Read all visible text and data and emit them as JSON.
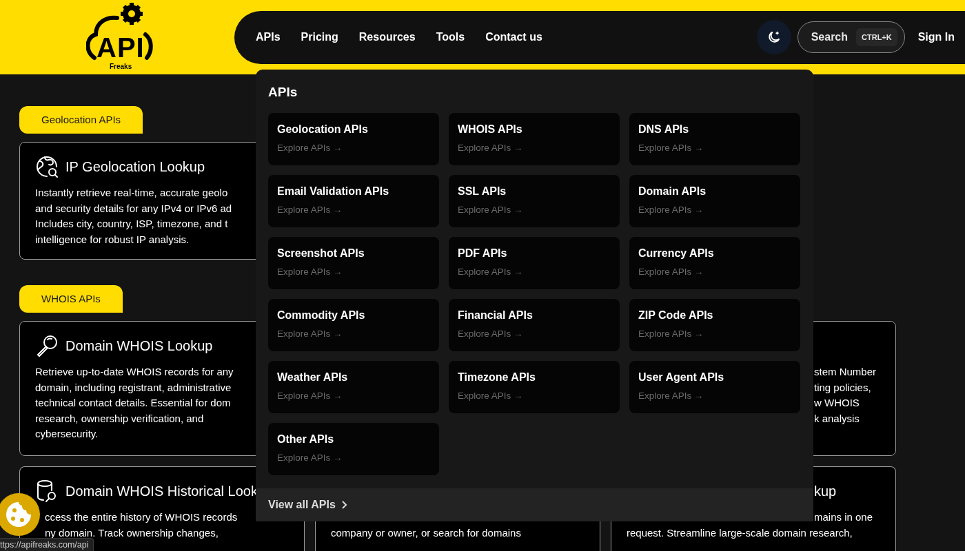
{
  "header": {
    "logo": {
      "word": "API",
      "sub": "Freaks"
    },
    "nav": [
      {
        "label": "APIs"
      },
      {
        "label": "Pricing"
      },
      {
        "label": "Resources"
      },
      {
        "label": "Tools"
      },
      {
        "label": "Contact us"
      }
    ],
    "search": {
      "label": "Search",
      "shortcut": "CTRL+K"
    },
    "sign_in": "Sign In"
  },
  "sections": [
    {
      "tag": "Geolocation APIs",
      "cards": [
        {
          "title": "IP Geolocation Lookup",
          "lines": [
            "Instantly retrieve real-time, accurate geolo",
            "and security details for any IPv4 or IPv6 ad",
            "Includes city, country, ISP, timezone, and t",
            "intelligence for robust IP analysis."
          ]
        }
      ]
    },
    {
      "tag": "WHOIS APIs",
      "cards": [
        {
          "title": "Domain WHOIS Lookup",
          "lines": [
            "Retrieve up-to-date WHOIS records for any",
            "domain, including registrant, administrative",
            "technical contact details. Essential for dom",
            "research, ownership verification, and",
            "cybersecurity."
          ]
        },
        {
          "lines": [
            "stem Number",
            "ting policies,",
            "w WHOIS",
            "k analysis"
          ]
        },
        {
          "title": "Domain WHOIS Historical Look",
          "lines": [
            "ccess the entire history of WHOIS records",
            "ny domain. Track ownership changes,"
          ]
        },
        {
          "lines": [
            "company or owner, or search for domains"
          ]
        },
        {
          "title": "kup",
          "lines": [
            "mains in one",
            "request. Streamline large-scale domain research,"
          ]
        }
      ]
    }
  ],
  "menu": {
    "heading": "APIs",
    "items": [
      {
        "title": "Geolocation APIs",
        "link": "Explore APIs →"
      },
      {
        "title": "WHOIS APIs",
        "link": "Explore APIs →"
      },
      {
        "title": "DNS APIs",
        "link": "Explore APIs →"
      },
      {
        "title": "Email Validation APIs",
        "link": "Explore APIs →"
      },
      {
        "title": "SSL APIs",
        "link": "Explore APIs →"
      },
      {
        "title": "Domain APIs",
        "link": "Explore APIs →"
      },
      {
        "title": "Screenshot APIs",
        "link": "Explore APIs →"
      },
      {
        "title": "PDF APIs",
        "link": "Explore APIs →"
      },
      {
        "title": "Currency APIs",
        "link": "Explore APIs →"
      },
      {
        "title": "Commodity APIs",
        "link": "Explore APIs →"
      },
      {
        "title": "Financial APIs",
        "link": "Explore APIs →"
      },
      {
        "title": "ZIP Code APIs",
        "link": "Explore APIs →"
      },
      {
        "title": "Weather APIs",
        "link": "Explore APIs →"
      },
      {
        "title": "Timezone APIs",
        "link": "Explore APIs →"
      },
      {
        "title": "User Agent APIs",
        "link": "Explore APIs →"
      },
      {
        "title": "Other APIs",
        "link": "Explore APIs →"
      }
    ],
    "footer": "View all APIs"
  },
  "status_bar": "ttps://apifreaks.com/api"
}
